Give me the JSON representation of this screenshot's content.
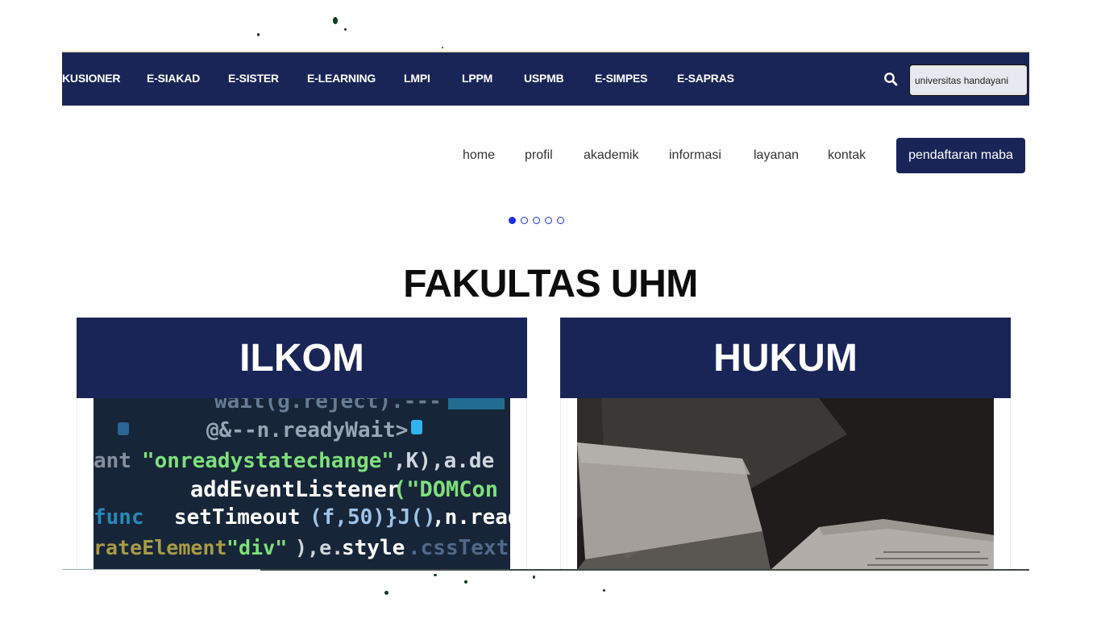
{
  "topbar": {
    "items": [
      "KUSIONER",
      "E-SIAKAD",
      "E-SISTER",
      "E-LEARNING",
      "LMPI",
      "LPPM",
      "USPMB",
      "E-SIMPES",
      "E-SAPRAS"
    ],
    "search_value": "universitas handayani"
  },
  "mainnav": {
    "items": [
      "home",
      "profil",
      "akademik",
      "informasi",
      "layanan",
      "kontak"
    ],
    "cta": "pendaftaran maba"
  },
  "carousel": {
    "count": 5,
    "active": 1
  },
  "section": {
    "title": "FAKULTAS UHM"
  },
  "faculties": [
    {
      "name": "ILKOM"
    },
    {
      "name": "HUKUM"
    }
  ],
  "colors": {
    "navy": "#1a2557",
    "dot_blue": "#1b2cf0"
  }
}
